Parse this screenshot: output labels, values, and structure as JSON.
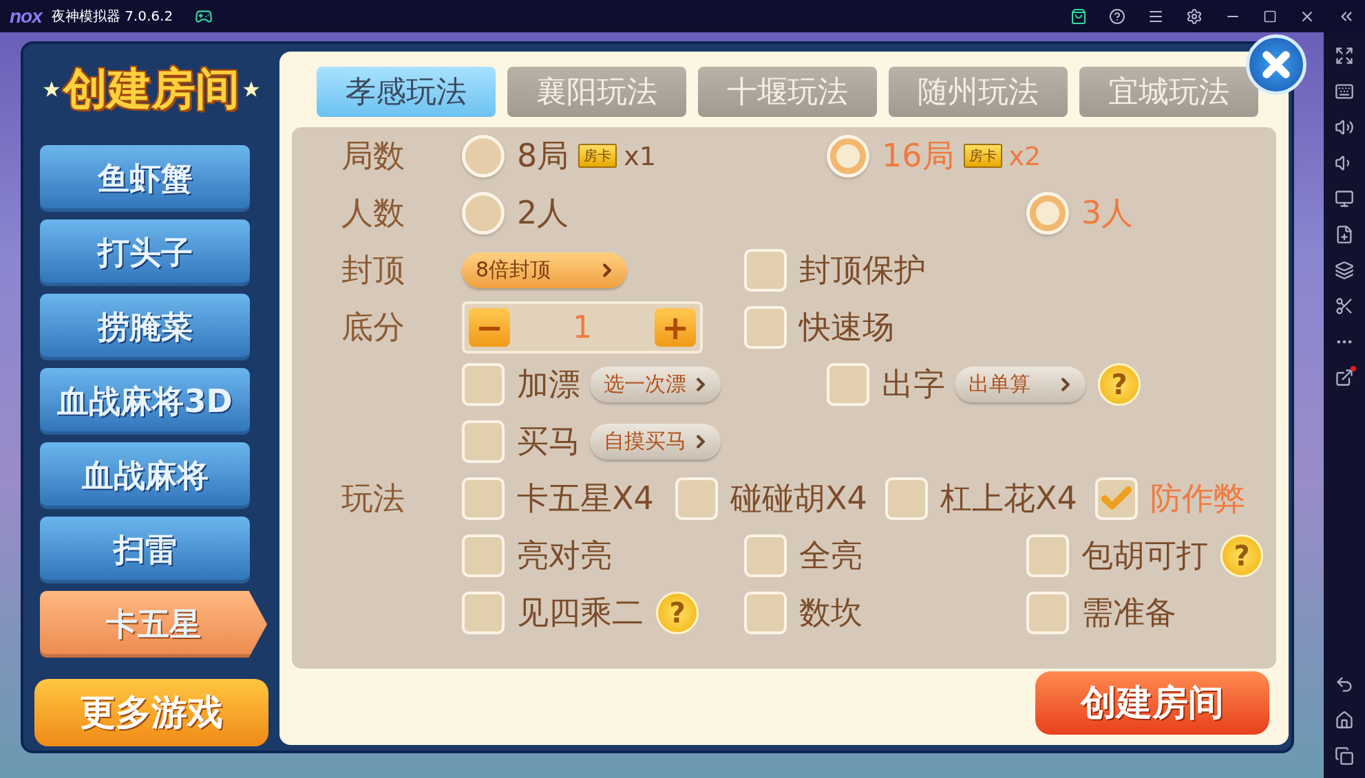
{
  "titlebar": {
    "logo": "nox",
    "app_name": "夜神模拟器 7.0.6.2"
  },
  "dialog": {
    "title": "创建房间",
    "games": [
      {
        "label": "鱼虾蟹",
        "selected": false
      },
      {
        "label": "打头子",
        "selected": false
      },
      {
        "label": "捞腌菜",
        "selected": false
      },
      {
        "label": "血战麻将3D",
        "selected": false
      },
      {
        "label": "血战麻将",
        "selected": false
      },
      {
        "label": "扫雷",
        "selected": false
      },
      {
        "label": "卡五星",
        "selected": true
      }
    ],
    "more_games": "更多游戏",
    "tabs": [
      {
        "label": "孝感玩法",
        "selected": true
      },
      {
        "label": "襄阳玩法",
        "selected": false
      },
      {
        "label": "十堰玩法",
        "selected": false
      },
      {
        "label": "随州玩法",
        "selected": false
      },
      {
        "label": "宜城玩法",
        "selected": false
      }
    ],
    "options": [
      {
        "label": "局数",
        "items": [
          {
            "kind": "radio",
            "label": "8局",
            "selected": false,
            "badge": "房卡",
            "cost": "x1"
          },
          {
            "kind": "radio",
            "label": "16局",
            "selected": true,
            "badge": "房卡",
            "cost": "x2"
          }
        ]
      },
      {
        "label": "人数",
        "items": [
          {
            "kind": "radio",
            "label": "2人",
            "selected": false
          },
          {
            "kind": "radio",
            "label": "3人",
            "selected": true
          }
        ]
      },
      {
        "label": "封顶",
        "items": [
          {
            "kind": "dropdown",
            "value": "8倍封顶"
          },
          {
            "kind": "checkbox",
            "label": "封顶保护",
            "checked": false
          }
        ]
      },
      {
        "label": "底分",
        "items": [
          {
            "kind": "stepper",
            "minus": "−",
            "value": "1",
            "plus": "+"
          },
          {
            "kind": "checkbox",
            "label": "快速场",
            "checked": false
          }
        ]
      },
      {
        "items": [
          {
            "kind": "checkbox",
            "label": "加漂",
            "checked": false,
            "dropdown": "选一次漂"
          },
          {
            "kind": "checkbox",
            "label": "出字",
            "checked": false,
            "dropdown": "出单算",
            "help": "?"
          }
        ]
      },
      {
        "items": [
          {
            "kind": "checkbox",
            "label": "买马",
            "checked": false,
            "dropdown": "自摸买马"
          }
        ]
      },
      {
        "label": "玩法",
        "items": [
          {
            "kind": "checkbox",
            "label": "卡五星X4",
            "checked": false
          },
          {
            "kind": "checkbox",
            "label": "碰碰胡X4",
            "checked": false
          },
          {
            "kind": "checkbox",
            "label": "杠上花X4",
            "checked": false
          },
          {
            "kind": "checkbox",
            "label": "防作弊",
            "checked": true
          }
        ]
      },
      {
        "items": [
          {
            "kind": "checkbox",
            "label": "亮对亮",
            "checked": false
          },
          {
            "kind": "checkbox",
            "label": "全亮",
            "checked": false
          },
          {
            "kind": "checkbox",
            "label": "包胡可打",
            "checked": false,
            "help": "?"
          }
        ]
      },
      {
        "items": [
          {
            "kind": "checkbox",
            "label": "见四乘二",
            "checked": false,
            "help": "?"
          },
          {
            "kind": "checkbox",
            "label": "数坎",
            "checked": false
          },
          {
            "kind": "checkbox",
            "label": "需准备",
            "checked": false
          }
        ]
      }
    ],
    "create_button": "创建房间"
  }
}
